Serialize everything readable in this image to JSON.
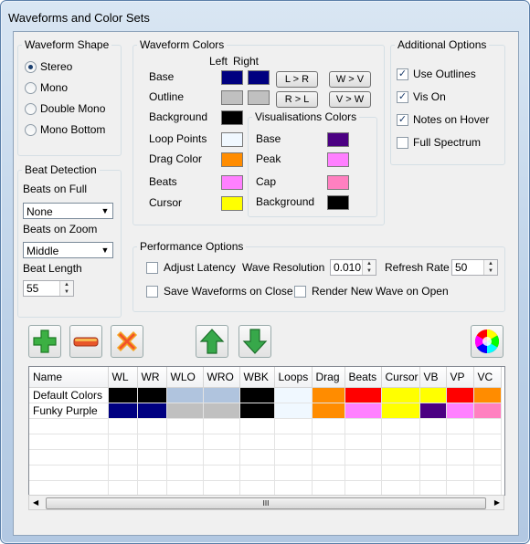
{
  "window": {
    "title": "Waveforms and Color Sets"
  },
  "waveform_shape": {
    "legend": "Waveform Shape",
    "options": [
      {
        "label": "Stereo",
        "selected": true
      },
      {
        "label": "Mono",
        "selected": false
      },
      {
        "label": "Double Mono",
        "selected": false
      },
      {
        "label": "Mono Bottom",
        "selected": false
      }
    ]
  },
  "waveform_colors": {
    "legend": "Waveform Colors",
    "col_left": "Left",
    "col_right": "Right",
    "base_label": "Base",
    "base_left": "#000080",
    "base_right": "#000080",
    "outline_label": "Outline",
    "outline_left": "#c0c0c0",
    "outline_right": "#c0c0c0",
    "background_label": "Background",
    "background_color": "#000000",
    "loop_points_label": "Loop Points",
    "loop_points_color": "#f0f8ff",
    "drag_color_label": "Drag Color",
    "drag_color": "#ff8c00",
    "beats_label": "Beats",
    "beats_color": "#ff80ff",
    "cursor_label": "Cursor",
    "cursor_color": "#ffff00",
    "btn_l_to_r": "L > R",
    "btn_r_to_l": "R > L",
    "btn_w_to_v": "W > V",
    "btn_v_to_w": "V > W"
  },
  "visualisations": {
    "legend": "Visualisations Colors",
    "base_label": "Base",
    "base_color": "#4b0082",
    "peak_label": "Peak",
    "peak_color": "#ff80ff",
    "cap_label": "Cap",
    "cap_color": "#ff80c0",
    "background_label": "Background",
    "background_color": "#000000"
  },
  "additional": {
    "legend": "Additional Options",
    "options": [
      {
        "label": "Use Outlines",
        "checked": true
      },
      {
        "label": "Vis On",
        "checked": true
      },
      {
        "label": "Notes on Hover",
        "checked": true
      },
      {
        "label": "Full Spectrum",
        "checked": false
      }
    ]
  },
  "beat_detection": {
    "legend": "Beat Detection",
    "on_full_label": "Beats on Full",
    "on_full_value": "None",
    "on_zoom_label": "Beats on Zoom",
    "on_zoom_value": "Middle",
    "length_label": "Beat Length",
    "length_value": "55"
  },
  "performance": {
    "legend": "Performance Options",
    "adjust_latency": "Adjust Latency",
    "wave_resolution_label": "Wave Resolution",
    "wave_resolution_value": "0.010",
    "refresh_rate_label": "Refresh Rate",
    "refresh_rate_value": "50",
    "save_waveforms": "Save Waveforms on Close",
    "render_new_wave": "Render New Wave on Open"
  },
  "toolbar": {
    "icons": [
      "add-icon",
      "remove-icon",
      "delete-icon",
      "move-up-icon",
      "move-down-icon",
      "color-wheel-icon"
    ]
  },
  "table": {
    "columns": [
      "Name",
      "WL",
      "WR",
      "WLO",
      "WRO",
      "WBK",
      "Loops",
      "Drag",
      "Beats",
      "Cursor",
      "VB",
      "VP",
      "VC"
    ],
    "rows": [
      {
        "name": "Default Colors",
        "colors": [
          "#000000",
          "#000000",
          "#b0c4de",
          "#b0c4de",
          "#000000",
          "#f0f8ff",
          "#ff8c00",
          "#ff0000",
          "#ffff00",
          "#ffff00",
          "#ff0000",
          "#ff8c00"
        ]
      },
      {
        "name": "Funky Purple",
        "colors": [
          "#000080",
          "#000080",
          "#c0c0c0",
          "#c0c0c0",
          "#000000",
          "#f0f8ff",
          "#ff8c00",
          "#ff80ff",
          "#ffff00",
          "#4b0082",
          "#ff80ff",
          "#ff80c0"
        ]
      }
    ],
    "scroll_thumb_glyph": "III"
  }
}
